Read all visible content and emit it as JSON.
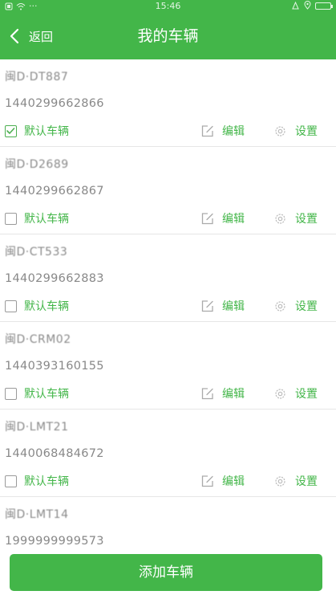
{
  "statusbar": {
    "time": "15:46",
    "dots": "···"
  },
  "header": {
    "back_label": "返回",
    "title": "我的车辆"
  },
  "vehicles": [
    {
      "plate": "闽D·DT887",
      "phone": "1440299662866",
      "is_default": true,
      "default_label": "默认车辆",
      "edit_label": "编辑",
      "settings_label": "设置"
    },
    {
      "plate": "闽D·D2689",
      "phone": "1440299662867",
      "is_default": false,
      "default_label": "默认车辆",
      "edit_label": "编辑",
      "settings_label": "设置"
    },
    {
      "plate": "闽D·CT533",
      "phone": "1440299662883",
      "is_default": false,
      "default_label": "默认车辆",
      "edit_label": "编辑",
      "settings_label": "设置"
    },
    {
      "plate": "闽D·CRM02",
      "phone": "1440393160155",
      "is_default": false,
      "default_label": "默认车辆",
      "edit_label": "编辑",
      "settings_label": "设置"
    },
    {
      "plate": "闽D·LMT21",
      "phone": "1440068484672",
      "is_default": false,
      "default_label": "默认车辆",
      "edit_label": "编辑",
      "settings_label": "设置"
    },
    {
      "plate": "闽D·LMT14",
      "phone": "1999999999573"
    }
  ],
  "footer": {
    "add_label": "添加车辆"
  },
  "colors": {
    "accent": "#43b649",
    "muted_text": "#888888",
    "divider": "#e6e6e6"
  },
  "icons": {
    "back": "chevron-left-icon",
    "check": "check-icon",
    "edit": "edit-icon",
    "settings": "gear-icon"
  }
}
